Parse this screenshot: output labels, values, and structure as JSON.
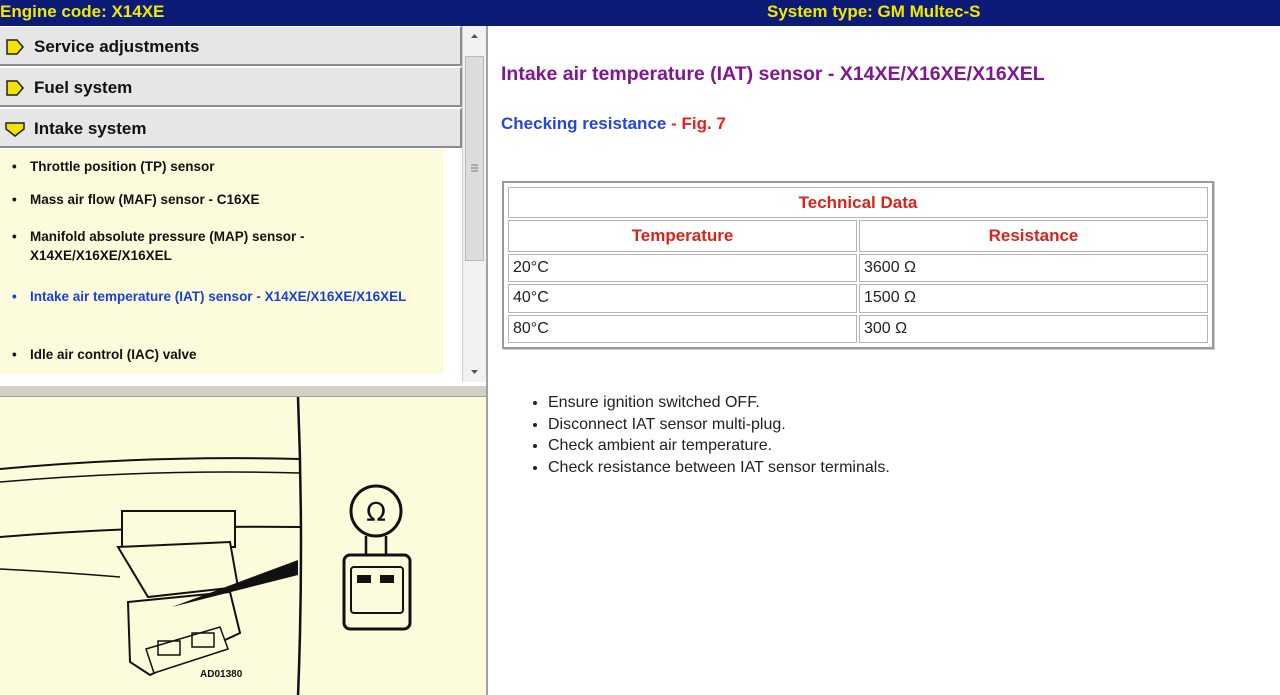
{
  "header": {
    "engine_code": "Engine code: X14XE",
    "system_type": "System type: GM Multec-S"
  },
  "nav": {
    "sections": [
      {
        "label": "Service adjustments",
        "expanded": false
      },
      {
        "label": "Fuel system",
        "expanded": false
      },
      {
        "label": "Intake system",
        "expanded": true
      }
    ],
    "items": [
      {
        "label": "Throttle position (TP) sensor",
        "active": false
      },
      {
        "label": "Mass air flow (MAF) sensor - C16XE",
        "active": false
      },
      {
        "label": "Manifold absolute pressure (MAP) sensor - X14XE/X16XE/X16XEL",
        "active": false
      },
      {
        "label": "Intake air temperature (IAT) sensor - X14XE/X16XE/X16XEL",
        "active": true
      },
      {
        "label": "Idle air control (IAC) valve",
        "active": false
      }
    ],
    "bullet": "•"
  },
  "figure": {
    "code": "AD01380",
    "ohm_symbol": "Ω"
  },
  "content": {
    "title": "Intake air temperature (IAT) sensor - X14XE/X16XE/X16XEL",
    "subtitle": "Checking resistance",
    "subtitle_sep": " - ",
    "fig_ref": "Fig. 7",
    "table": {
      "caption": "Technical Data",
      "columns": [
        "Temperature",
        "Resistance"
      ],
      "rows": [
        [
          "20°C",
          "3600 Ω"
        ],
        [
          "40°C",
          "1500 Ω"
        ],
        [
          "80°C",
          "300 Ω"
        ]
      ]
    },
    "steps": [
      "Ensure ignition switched OFF.",
      "Disconnect IAT sensor multi-plug.",
      "Check ambient air temperature.",
      "Check resistance between IAT sensor terminals."
    ]
  },
  "colors": {
    "header_bg": "#0c1a78",
    "header_text": "#f3e800",
    "title": "#80178f",
    "subtitle": "#2448d6",
    "accent_red": "#e3221c",
    "panel_bg": "#fcfcdc",
    "active_link": "#1a3fd6"
  },
  "icons": {
    "section_collapsed": "arrow-right-icon",
    "section_expanded": "arrow-down-icon"
  }
}
